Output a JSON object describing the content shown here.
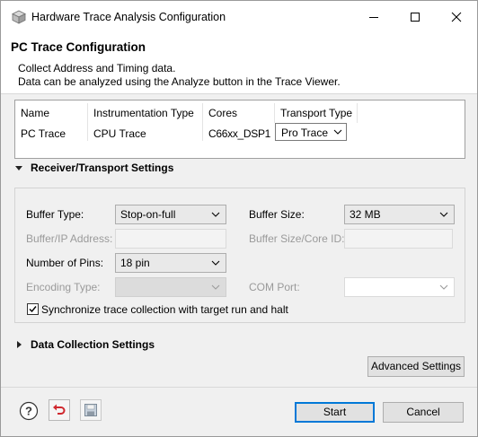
{
  "window": {
    "title": "Hardware Trace Analysis Configuration"
  },
  "header": {
    "title": "PC Trace Configuration",
    "description_line1": "Collect Address and Timing data.",
    "description_line2": "Data can be analyzed using the Analyze button in the Trace Viewer."
  },
  "table": {
    "columns": [
      "Name",
      "Instrumentation Type",
      "Cores",
      "Transport Type"
    ],
    "rows": [
      {
        "name": "PC Trace",
        "instrumentation_type": "CPU Trace",
        "cores": "C66xx_DSP1",
        "transport_type": "Pro Trace"
      }
    ]
  },
  "receiver": {
    "section_title": "Receiver/Transport Settings",
    "expanded": true,
    "buffer_type_label": "Buffer Type:",
    "buffer_type_value": "Stop-on-full",
    "buffer_size_label": "Buffer Size:",
    "buffer_size_value": "32 MB",
    "buffer_ip_label": "Buffer/IP Address:",
    "buffer_ip_value": "",
    "buffer_size_core_label": "Buffer Size/Core ID:",
    "buffer_size_core_value": "",
    "num_pins_label": "Number of Pins:",
    "num_pins_value": "18 pin",
    "encoding_label": "Encoding Type:",
    "encoding_value": "",
    "com_port_label": "COM Port:",
    "com_port_value": "",
    "sync_label": "Synchronize trace collection with target run and halt",
    "sync_checked": true
  },
  "data_collection": {
    "section_title": "Data Collection Settings",
    "expanded": false
  },
  "buttons": {
    "advanced": "Advanced Settings",
    "start": "Start",
    "cancel": "Cancel"
  },
  "icons": {
    "help": "help-icon",
    "restore": "restore-defaults-icon",
    "save": "save-icon"
  },
  "colors": {
    "dialog_bg": "#f0f0f0",
    "accent": "#0078d7",
    "disabled_text": "#9a9a9a",
    "restore_red": "#d0282e"
  }
}
